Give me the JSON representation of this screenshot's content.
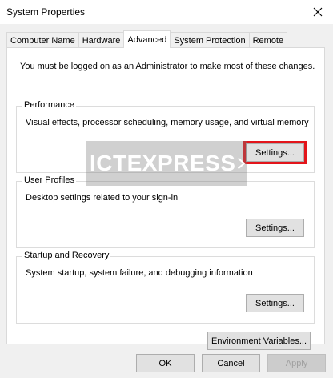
{
  "window": {
    "title": "System Properties"
  },
  "tabs": [
    {
      "label": "Computer Name",
      "active": false
    },
    {
      "label": "Hardware",
      "active": false
    },
    {
      "label": "Advanced",
      "active": true
    },
    {
      "label": "System Protection",
      "active": false
    },
    {
      "label": "Remote",
      "active": false
    }
  ],
  "advanced": {
    "intro": "You must be logged on as an Administrator to make most of these changes.",
    "performance": {
      "title": "Performance",
      "description": "Visual effects, processor scheduling, memory usage, and virtual memory",
      "button": "Settings..."
    },
    "user_profiles": {
      "title": "User Profiles",
      "description": "Desktop settings related to your sign-in",
      "button": "Settings..."
    },
    "startup": {
      "title": "Startup and Recovery",
      "description": "System startup, system failure, and debugging information",
      "button": "Settings..."
    },
    "env_button": "Environment Variables..."
  },
  "footer": {
    "ok": "OK",
    "cancel": "Cancel",
    "apply": "Apply"
  },
  "watermark": {
    "text": "ICTEXPRESS"
  },
  "colors": {
    "highlight": "#e3151b",
    "button_face": "#e1e1e1",
    "dialog_bg": "#f0f0f0"
  }
}
